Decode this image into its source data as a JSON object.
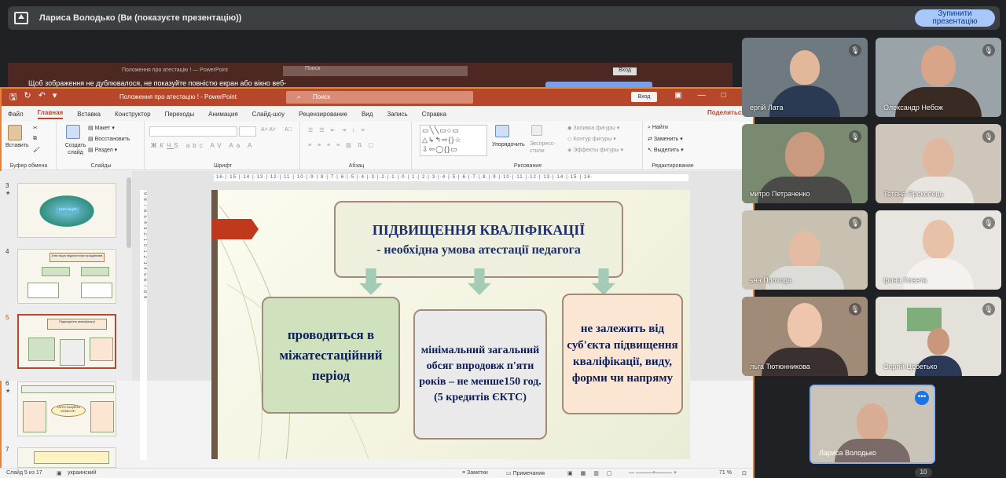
{
  "meet": {
    "presenting_label": "Лариса Володько (Ви (показуєте презентацію))",
    "stop_button": "Зупинити презентацію",
    "participant_count": "10",
    "participants": [
      {
        "name": "ергій Лата",
        "muted": true
      },
      {
        "name": "Олександр Небож",
        "muted": true
      },
      {
        "name": "митро Петраченко",
        "muted": true
      },
      {
        "name": "Тетяна Прокопець",
        "muted": true
      },
      {
        "name": "ьна Прохода",
        "muted": true
      },
      {
        "name": "Ірина Хланта",
        "muted": true
      },
      {
        "name": "льга Тютюнникова",
        "muted": true
      },
      {
        "name": "Сергій Цебетько",
        "muted": true
      }
    ],
    "self_name": "Лариса Володько"
  },
  "ghost": {
    "title": "Положення про атестацію ! — PowerPoint",
    "search": "Поиск",
    "login": "Вход",
    "warning": "Щоб зображення не дублювалося, не показуйте повністю екран або вікно веб-"
  },
  "ppt": {
    "doc_title": "Положення про атестацію ! - PowerPoint",
    "search_placeholder": "Поиск",
    "login": "Вход",
    "menu": [
      "Файл",
      "Главная",
      "Вставка",
      "Конструктор",
      "Переходы",
      "Анимация",
      "Слайд-шоу",
      "Рецензирование",
      "Вид",
      "Запись",
      "Справка"
    ],
    "active_menu": "Главная",
    "share": "Поделиться",
    "ribbon": {
      "paste": "Вставить",
      "clipboard": "Буфер обмена",
      "create_slide": "Создать слайд",
      "layout": "Макет",
      "reset": "Восстановить",
      "section": "Раздел",
      "slides": "Слайды",
      "font": "Шрифт",
      "paragraph": "Абзац",
      "arrange": "Упорядочить",
      "express_styles": "Экспресс-стили",
      "fill": "Заливка фигуры",
      "outline": "Контур фигуры",
      "effects": "Эффекты фигуры",
      "drawing": "Рисование",
      "find": "Найти",
      "replace": "Заменить",
      "select": "Выделить",
      "editing": "Редактирование"
    },
    "thumbnails": [
      {
        "num": "3",
        "title": "АТЕСТАЦІЯ"
      },
      {
        "num": "4",
        "title": "Атестація педагогічних працівників"
      },
      {
        "num": "5",
        "title": "Підвищення кваліфікації"
      },
      {
        "num": "6",
        "title": "«АТЕСТАЦІЙНА КОМІСІЯ»"
      },
      {
        "num": "7",
        "title": ""
      }
    ],
    "ruler_h": "·16·|·15·|·14·|·13·|·12·|·11·|·10·|·9·|·8·|·7·|·6·|·5·|·4·|·3·|·2·|·1·|·0·|·1·|·2·|·3·|·4·|·5·|·6·|·7·|·8·|·9·|·10·|·11·|·12·|·13·|·14·|·15·|·16·",
    "ruler_v": "·9·8·7·6·5·4·3·2·1·0·1·2·3·4·5·6·7·8·9·",
    "status": {
      "slide": "Слайд 5 из 17",
      "language": "украинский",
      "notes": "Заметки",
      "comments": "Примечания",
      "zoom": "71 %"
    }
  },
  "slide": {
    "title": "ПІДВИЩЕННЯ КВАЛІФІКАЦІЇ",
    "subtitle": "- необхідна умова атестації педагога",
    "left_box": "проводиться в міжатестаційний період",
    "mid_box": "мінімальний загальний обсяг впродовж п'яти років – не менше150 год. (5 кредитів ЄКТС)",
    "right_box": "не залежить від суб'єкта підвищення кваліфікації, виду, форми чи напряму"
  }
}
